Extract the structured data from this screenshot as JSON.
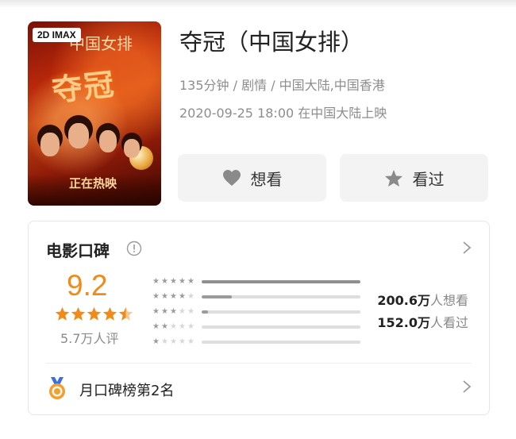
{
  "movie": {
    "poster_badge": "2D IMAX",
    "poster_title_text": "夺冠",
    "poster_subtitle_text": "中国女排",
    "poster_tagline": "正在热映",
    "title": "夺冠（中国女排）",
    "meta_line1": "135分钟 / 剧情 / 中国大陆,中国香港",
    "meta_line2": "2020-09-25 18:00 在中国大陆上映"
  },
  "actions": {
    "want_label": "想看",
    "want_icon": "heart-icon",
    "seen_label": "看过",
    "seen_icon": "star-icon"
  },
  "rating": {
    "section_title": "电影口碑",
    "score": "9.2",
    "score_stars": 4.5,
    "count": "5.7万人评",
    "distribution": [
      {
        "stars": 5,
        "fraction": 1.0
      },
      {
        "stars": 4,
        "fraction": 0.19
      },
      {
        "stars": 3,
        "fraction": 0.04
      },
      {
        "stars": 2,
        "fraction": 0.0
      },
      {
        "stars": 1,
        "fraction": 0.0
      }
    ],
    "want_count": "200.6万",
    "want_label": "人想看",
    "seen_count": "152.0万",
    "seen_label": "人看过",
    "rank_text": "月口碑榜第2名",
    "accent": "#f08a18"
  }
}
